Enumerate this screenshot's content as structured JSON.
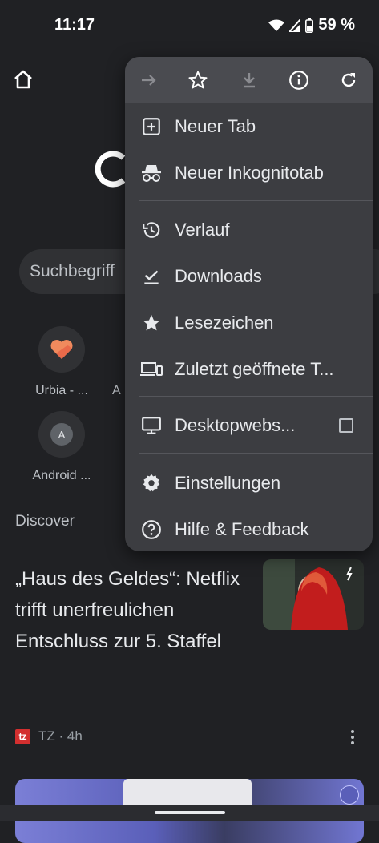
{
  "status_bar": {
    "time": "11:17",
    "battery_percent": "59 %"
  },
  "ntp": {
    "search_placeholder": "Suchbegriff",
    "shortcuts": [
      {
        "label": "Urbia - ...",
        "icon": "urbia-heart-icon"
      },
      {
        "label": "A",
        "icon": "a-letter-icon"
      },
      {
        "label": "Android ...",
        "icon": "android-letter-icon",
        "letter": "A"
      }
    ],
    "discover_label": "Discover",
    "article": {
      "headline": "„Haus des Geldes“: Netflix trifft unerfreulichen Entschluss zur 5. Staffel",
      "source_badge": "tz",
      "source_meta": "TZ · 4h"
    }
  },
  "menu": {
    "toolbar": [
      "forward-icon",
      "bookmark-star-icon",
      "download-icon",
      "info-icon",
      "reload-icon"
    ],
    "items": [
      {
        "label": "Neuer Tab",
        "icon": "new-tab-icon"
      },
      {
        "label": "Neuer Inkognitotab",
        "icon": "incognito-icon"
      },
      {
        "label": "Verlauf",
        "icon": "history-icon"
      },
      {
        "label": "Downloads",
        "icon": "downloads-check-icon"
      },
      {
        "label": "Lesezeichen",
        "icon": "bookmarks-star-icon"
      },
      {
        "label": "Zuletzt geöffnete T...",
        "icon": "recent-tabs-icon"
      },
      {
        "label": "Desktopwebs...",
        "icon": "desktop-icon",
        "checked": false
      },
      {
        "label": "Einstellungen",
        "icon": "settings-gear-icon"
      },
      {
        "label": "Hilfe & Feedback",
        "icon": "help-icon"
      }
    ]
  },
  "colors": {
    "background": "#202124",
    "menu": "#3c3d41",
    "menu_toolbar": "#4a4b50",
    "text": "#e8eaed",
    "secondary_text": "#bdc1c6"
  }
}
